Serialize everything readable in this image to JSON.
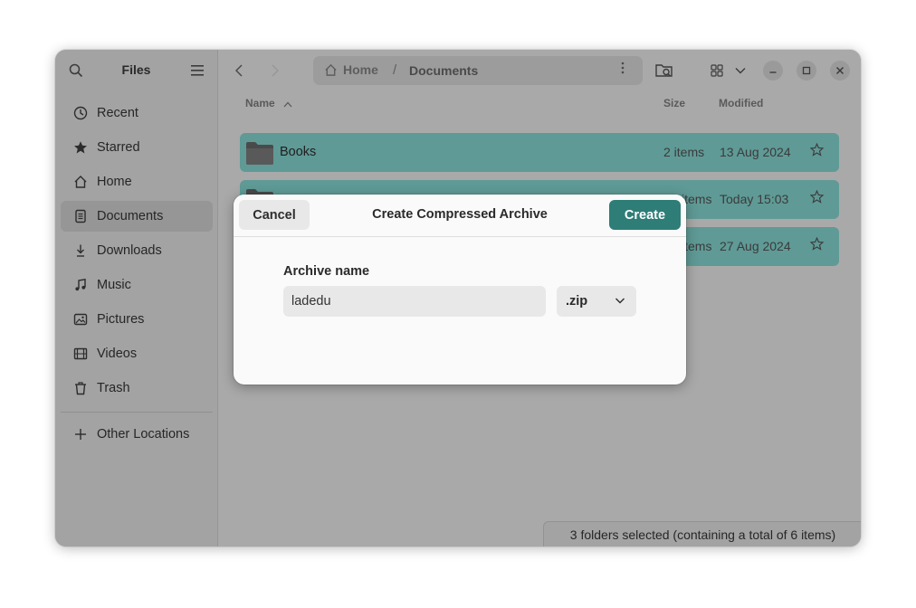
{
  "sidebar": {
    "title": "Files",
    "items": [
      {
        "label": "Recent",
        "icon": "clock-icon"
      },
      {
        "label": "Starred",
        "icon": "star-icon"
      },
      {
        "label": "Home",
        "icon": "home-icon"
      },
      {
        "label": "Documents",
        "icon": "document-icon"
      },
      {
        "label": "Downloads",
        "icon": "download-icon"
      },
      {
        "label": "Music",
        "icon": "music-icon"
      },
      {
        "label": "Pictures",
        "icon": "picture-icon"
      },
      {
        "label": "Videos",
        "icon": "video-icon"
      },
      {
        "label": "Trash",
        "icon": "trash-icon"
      }
    ],
    "other_locations": "Other Locations"
  },
  "pathbar": {
    "home": "Home",
    "separator": "/",
    "current": "Documents"
  },
  "columns": {
    "name": "Name",
    "size": "Size",
    "modified": "Modified"
  },
  "files": [
    {
      "name": "Books",
      "size": "2 items",
      "modified": "13 Aug 2024"
    },
    {
      "name": "",
      "size": "items",
      "modified": "Today 15:03"
    },
    {
      "name": "",
      "size": "items",
      "modified": "27 Aug 2024"
    }
  ],
  "status": "3 folders selected  (containing a total of 6 items)",
  "dialog": {
    "cancel_label": "Cancel",
    "title": "Create Compressed Archive",
    "create_label": "Create",
    "archive_label": "Archive name",
    "archive_value": "ladedu",
    "extension": ".zip"
  },
  "colors": {
    "accent": "#2e7d77",
    "selected_row": "#5f9a96"
  }
}
